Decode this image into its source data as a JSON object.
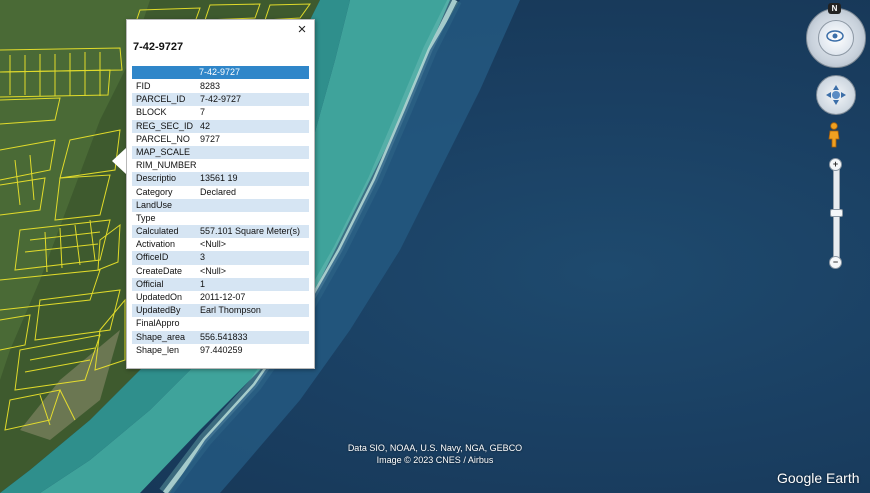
{
  "popup": {
    "title": "7-42-9727",
    "header_value": "7-42-9727",
    "close_label": "×",
    "rows": [
      {
        "key": "FID",
        "value": "8283"
      },
      {
        "key": "PARCEL_ID",
        "value": "7-42-9727"
      },
      {
        "key": "BLOCK",
        "value": "7"
      },
      {
        "key": "REG_SEC_ID",
        "value": "42"
      },
      {
        "key": "PARCEL_NO",
        "value": "9727"
      },
      {
        "key": "MAP_SCALE",
        "value": ""
      },
      {
        "key": "RIM_NUMBER",
        "value": ""
      },
      {
        "key": "Descriptio",
        "value": "13561 19"
      },
      {
        "key": "Category",
        "value": "Declared"
      },
      {
        "key": "LandUse",
        "value": ""
      },
      {
        "key": "Type",
        "value": ""
      },
      {
        "key": "Calculated",
        "value": "557.101 Square Meter(s)"
      },
      {
        "key": "Activation",
        "value": "<Null>"
      },
      {
        "key": "OfficeID",
        "value": "3"
      },
      {
        "key": "CreateDate",
        "value": "<Null>"
      },
      {
        "key": "Official",
        "value": "1"
      },
      {
        "key": "UpdatedOn",
        "value": "2011-12-07"
      },
      {
        "key": "UpdatedBy",
        "value": "Earl Thompson"
      },
      {
        "key": "FinalAppro",
        "value": ""
      },
      {
        "key": "Shape_area",
        "value": "556.541833"
      },
      {
        "key": "Shape_len",
        "value": "97.440259"
      }
    ]
  },
  "nav": {
    "compass_label": "N",
    "zoom_in_label": "+",
    "zoom_out_label": "−"
  },
  "attribution": {
    "line1": "Data SIO, NOAA, U.S. Navy, NGA, GEBCO",
    "line2": "Image © 2023 CNES / Airbus"
  },
  "logo": "Google Earth",
  "colors": {
    "header_blue": "#2f86c9",
    "row_alt": "#d6e5f3",
    "parcel_yellow": "#f2e82a",
    "ocean": "#1a3f62"
  }
}
